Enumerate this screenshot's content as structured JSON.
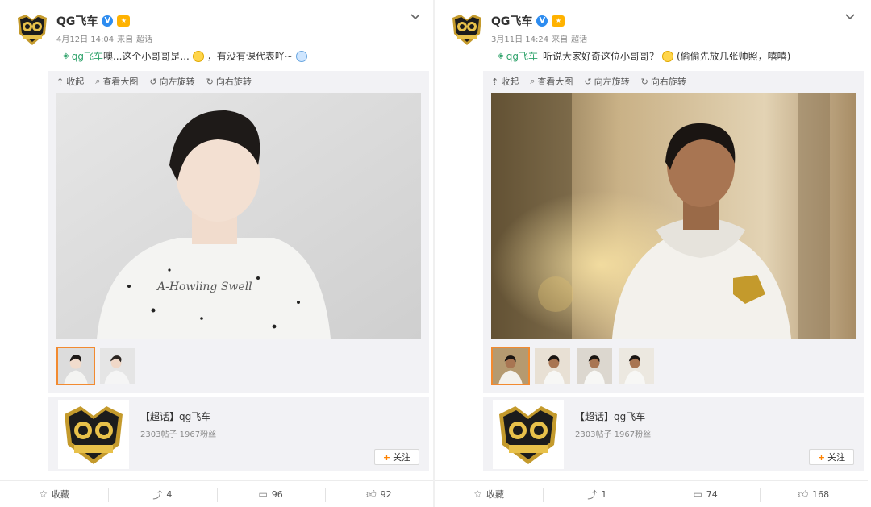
{
  "posts": [
    {
      "author": "QG飞车",
      "time": "4月12日 14:04",
      "source_prefix": "来自",
      "source": "超话",
      "topic_link": "qg飞车",
      "text_a": "噢...这个小哥哥是...",
      "text_b": "，有没有课代表吖~",
      "toolbar": [
        "收起",
        "查看大图",
        "向左旋转",
        "向右旋转"
      ],
      "topic": {
        "title": "【超话】qg飞车",
        "stats": "2303帖子 1967粉丝",
        "follow": "关注"
      },
      "footer": {
        "favorite": "收藏",
        "repost": "4",
        "comment": "96",
        "like": "92"
      }
    },
    {
      "author": "QG飞车",
      "time": "3月11日 14:24",
      "source_prefix": "来自",
      "source": "超话",
      "topic_link": "qg飞车",
      "text_a": "听说大家好奇这位小哥哥？",
      "text_b": "(偷偷先放几张帅照，嘻嘻)",
      "toolbar": [
        "收起",
        "查看大图",
        "向左旋转",
        "向右旋转"
      ],
      "topic": {
        "title": "【超话】qg飞车",
        "stats": "2303帖子 1967粉丝",
        "follow": "关注"
      },
      "footer": {
        "favorite": "收藏",
        "repost": "1",
        "comment": "74",
        "like": "168"
      }
    }
  ],
  "icons": {
    "collapse": "up-arrow-icon",
    "view_large": "magnifier-icon",
    "rotate_left": "rotate-left-icon",
    "rotate_right": "rotate-right-icon",
    "favorite": "star-icon",
    "repost": "repost-icon",
    "comment": "comment-icon",
    "like": "thumbs-up-icon"
  },
  "colors": {
    "accent_orange": "#f28a30",
    "link_green": "#2fa36b",
    "verified_blue": "#2d8cf0",
    "panel_bg": "#f2f2f5"
  }
}
